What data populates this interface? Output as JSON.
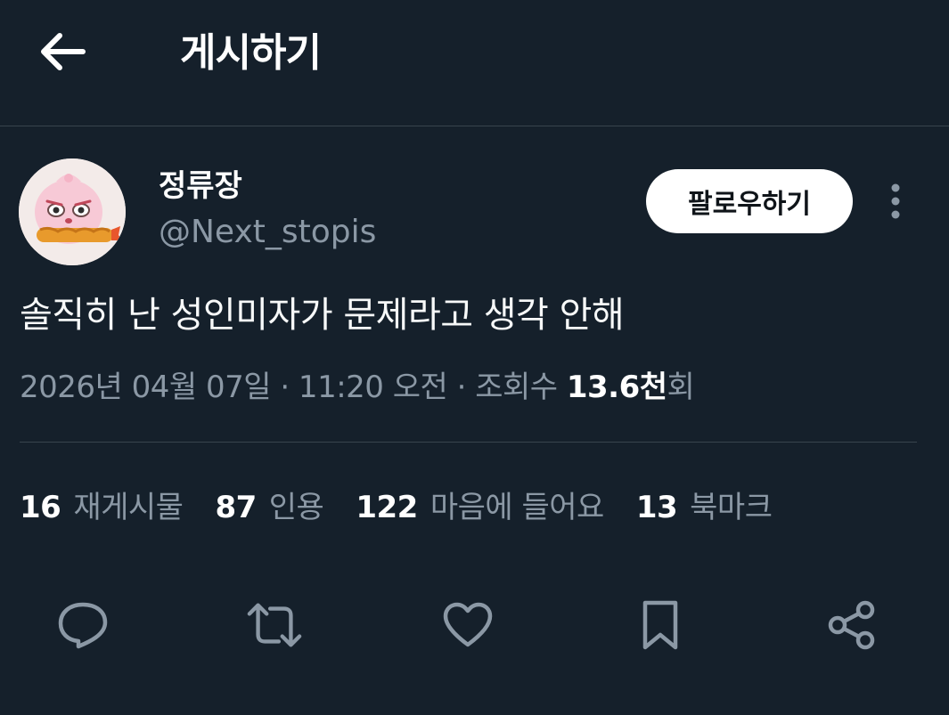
{
  "header": {
    "title": "게시하기"
  },
  "author": {
    "display_name": "정류장",
    "handle": "@Next_stopis",
    "follow_label": "팔로우하기"
  },
  "post": {
    "text": "솔직히 난 성인미자가 문제라고 생각 안해",
    "timestamp": "2026년 04월 07일 · 11:20 오전 · 조회수 ",
    "views_count": "13.6천",
    "views_suffix": "회"
  },
  "stats": [
    {
      "count": "16",
      "label": "재게시물"
    },
    {
      "count": "87",
      "label": "인용"
    },
    {
      "count": "122",
      "label": "마음에 들어요"
    },
    {
      "count": "13",
      "label": "북마크"
    }
  ],
  "actions": {
    "reply": "reply-icon",
    "repost": "repost-icon",
    "like": "heart-icon",
    "bookmark": "bookmark-icon",
    "share": "share-icon"
  },
  "colors": {
    "background": "#15202b",
    "secondary_text": "#8b98a5",
    "divider": "#38444d"
  }
}
